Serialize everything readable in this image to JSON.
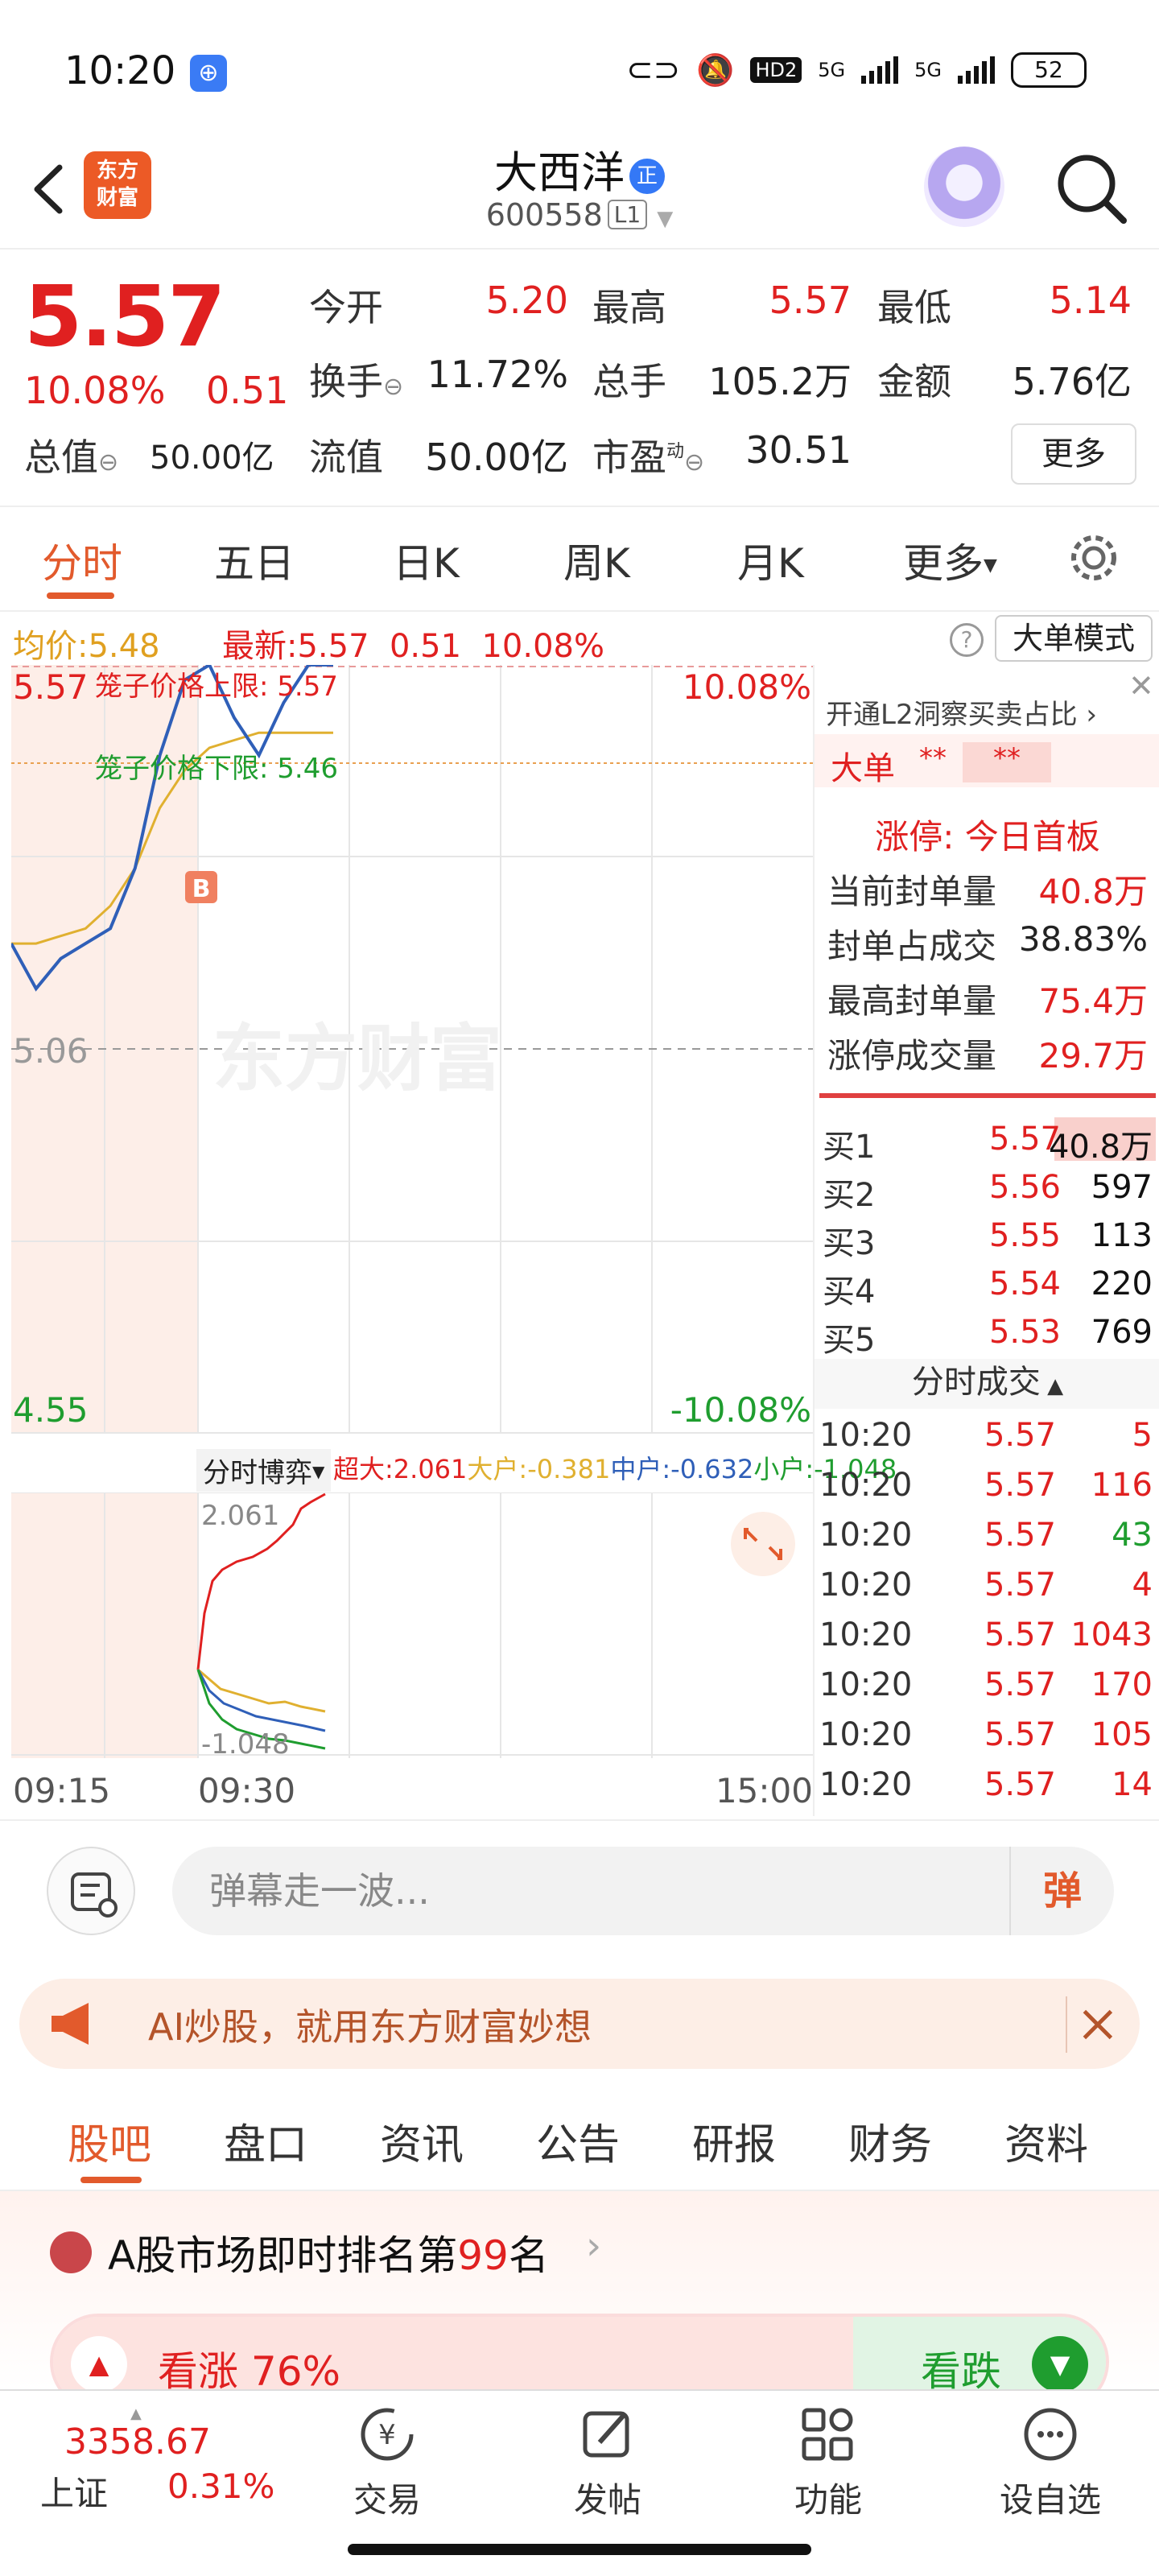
{
  "status_bar": {
    "time": "10:20",
    "net_hd": "HD2",
    "net_5g_1": "5G",
    "net_5g_2": "5G",
    "battery": "52"
  },
  "header": {
    "brand_line1": "东方",
    "brand_line2": "财富",
    "stock_name": "大西洋",
    "badge": "正",
    "stock_code": "600558",
    "level": "L1"
  },
  "quote": {
    "price": "5.57",
    "change_pct": "10.08%",
    "change": "0.51",
    "fields": [
      {
        "label": "今开",
        "value": "5.20",
        "color": "red"
      },
      {
        "label": "最高",
        "value": "5.57",
        "color": "red"
      },
      {
        "label": "最低",
        "value": "5.14",
        "color": "red"
      },
      {
        "label": "换手",
        "value": "11.72%",
        "color": "dark"
      },
      {
        "label": "总手",
        "value": "105.2万",
        "color": "dark"
      },
      {
        "label": "金额",
        "value": "5.76亿",
        "color": "dark"
      },
      {
        "label": "总值",
        "value": "50.00亿",
        "color": "dark"
      },
      {
        "label": "流值",
        "value": "50.00亿",
        "color": "dark"
      },
      {
        "label": "市盈",
        "value": "30.51",
        "color": "dark"
      }
    ],
    "pe_sup": "动",
    "more": "更多"
  },
  "chart_tabs": [
    "分时",
    "五日",
    "日K",
    "周K",
    "月K",
    "更多"
  ],
  "infoline": {
    "avg_label": "均价:",
    "avg": "5.48",
    "latest_label": "最新:",
    "latest": "5.57",
    "chg": "0.51",
    "pct": "10.08%",
    "help": "?",
    "big_order": "大单模式"
  },
  "chart_data": {
    "type": "line",
    "y_labels": {
      "top": "5.57",
      "mid": "5.06",
      "bottom": "4.55"
    },
    "pct_labels": {
      "top": "10.08%",
      "bottom": "-10.08%"
    },
    "cage_upper": "笼子价格上限: 5.57",
    "cage_lower": "笼子价格下限: 5.46",
    "buy_marker": "B",
    "watermark": "东方财富",
    "ylim": [
      4.55,
      5.57
    ],
    "x": [
      "09:15",
      "09:30",
      "15:00"
    ],
    "series": [
      {
        "name": "price",
        "color": "#2f5fb8",
        "values": [
          5.2,
          5.14,
          5.18,
          5.2,
          5.22,
          5.3,
          5.45,
          5.55,
          5.57,
          5.5,
          5.45,
          5.52,
          5.57,
          5.57
        ]
      },
      {
        "name": "avg",
        "color": "#e0b030",
        "values": [
          5.2,
          5.2,
          5.21,
          5.22,
          5.25,
          5.3,
          5.38,
          5.43,
          5.46,
          5.47,
          5.48,
          5.48,
          5.48,
          5.48
        ]
      }
    ]
  },
  "sub_chart": {
    "selector": "分时博弈",
    "legend": [
      {
        "label": "超大:2.061",
        "color": "#e02020"
      },
      {
        "label": "大户:-0.381",
        "color": "#e0b030"
      },
      {
        "label": "中户:-0.632",
        "color": "#2f5fb8"
      },
      {
        "label": "小户:-1.048",
        "color": "#1f9d2f"
      }
    ],
    "top": "2.061",
    "bottom": "-1.048"
  },
  "time_axis": [
    "09:15",
    "09:30",
    "15:00"
  ],
  "l2": {
    "title": "开通L2洞察买卖占比",
    "big_order_label": "大单",
    "big_order_a": "**",
    "big_order_b": "**",
    "limit_status": "涨停: 今日首板",
    "stats": [
      {
        "label": "当前封单量",
        "value": "40.8万"
      },
      {
        "label": "封单占成交",
        "value": "38.83%"
      },
      {
        "label": "最高封单量",
        "value": "75.4万"
      },
      {
        "label": "涨停成交量",
        "value": "29.7万"
      }
    ]
  },
  "order_book": [
    {
      "label": "买1",
      "price": "5.57",
      "volume": "40.8万"
    },
    {
      "label": "买2",
      "price": "5.56",
      "volume": "597"
    },
    {
      "label": "买3",
      "price": "5.55",
      "volume": "113"
    },
    {
      "label": "买4",
      "price": "5.54",
      "volume": "220"
    },
    {
      "label": "买5",
      "price": "5.53",
      "volume": "769"
    }
  ],
  "trades_title": "分时成交",
  "trades": [
    {
      "time": "10:20",
      "price": "5.57",
      "volume": "5"
    },
    {
      "time": "10:20",
      "price": "5.57",
      "volume": "116"
    },
    {
      "time": "10:20",
      "price": "5.57",
      "volume": "43"
    },
    {
      "time": "10:20",
      "price": "5.57",
      "volume": "4"
    },
    {
      "time": "10:20",
      "price": "5.57",
      "volume": "1043"
    },
    {
      "time": "10:20",
      "price": "5.57",
      "volume": "170"
    },
    {
      "time": "10:20",
      "price": "5.57",
      "volume": "105"
    },
    {
      "time": "10:20",
      "price": "5.57",
      "volume": "14"
    }
  ],
  "danmu": {
    "placeholder": "弹幕走一波...",
    "send": "弹"
  },
  "ai_banner": {
    "text": "AI炒股，就用东方财富妙想"
  },
  "section_tabs": [
    "股吧",
    "盘口",
    "资讯",
    "公告",
    "研报",
    "财务",
    "资料"
  ],
  "rank": {
    "prefix": "A股市场即时排名第",
    "number": "99",
    "suffix": "名"
  },
  "vote": {
    "up_label": "看涨 76%",
    "up_pct": 76,
    "down_label": "看跌"
  },
  "bottom_nav": {
    "index_value": "3358.67",
    "index_name": "上证",
    "index_pct": "0.31%",
    "items": [
      {
        "label": "交易",
        "icon": "yen-icon"
      },
      {
        "label": "发帖",
        "icon": "edit-icon"
      },
      {
        "label": "功能",
        "icon": "grid-icon"
      },
      {
        "label": "设自选",
        "icon": "more-icon"
      }
    ]
  }
}
